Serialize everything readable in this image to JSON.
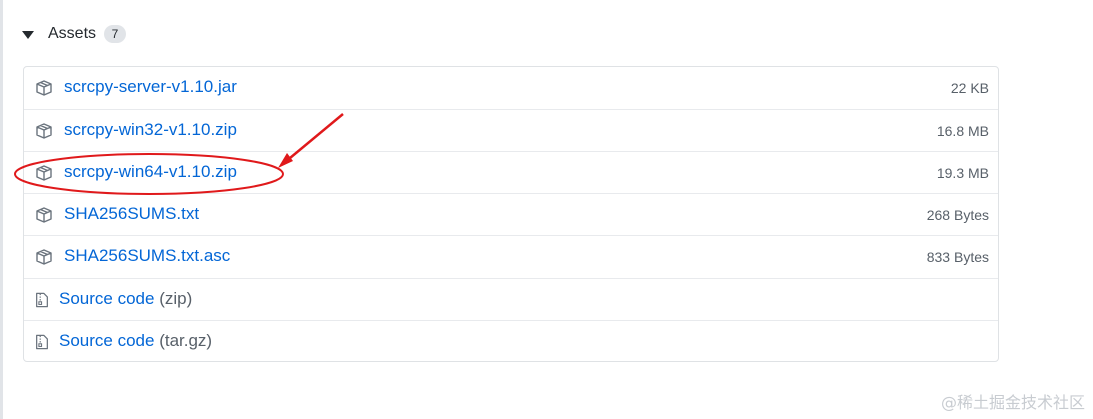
{
  "assets": {
    "title": "Assets",
    "count": "7",
    "items": [
      {
        "name": "scrcpy-server-v1.10.jar",
        "size": "22 KB",
        "icon": "package-icon"
      },
      {
        "name": "scrcpy-win32-v1.10.zip",
        "size": "16.8 MB",
        "icon": "package-icon"
      },
      {
        "name": "scrcpy-win64-v1.10.zip",
        "size": "19.3 MB",
        "icon": "package-icon",
        "highlighted": true
      },
      {
        "name": "SHA256SUMS.txt",
        "size": "268 Bytes",
        "icon": "package-icon"
      },
      {
        "name": "SHA256SUMS.txt.asc",
        "size": "833 Bytes",
        "icon": "package-icon"
      }
    ],
    "source": [
      {
        "name": "Source code",
        "suffix": "(zip)",
        "icon": "file-zip-icon"
      },
      {
        "name": "Source code",
        "suffix": "(tar.gz)",
        "icon": "file-zip-icon"
      }
    ]
  },
  "annotation": {
    "color": "#e0191b"
  },
  "watermark": "@稀土掘金技术社区"
}
